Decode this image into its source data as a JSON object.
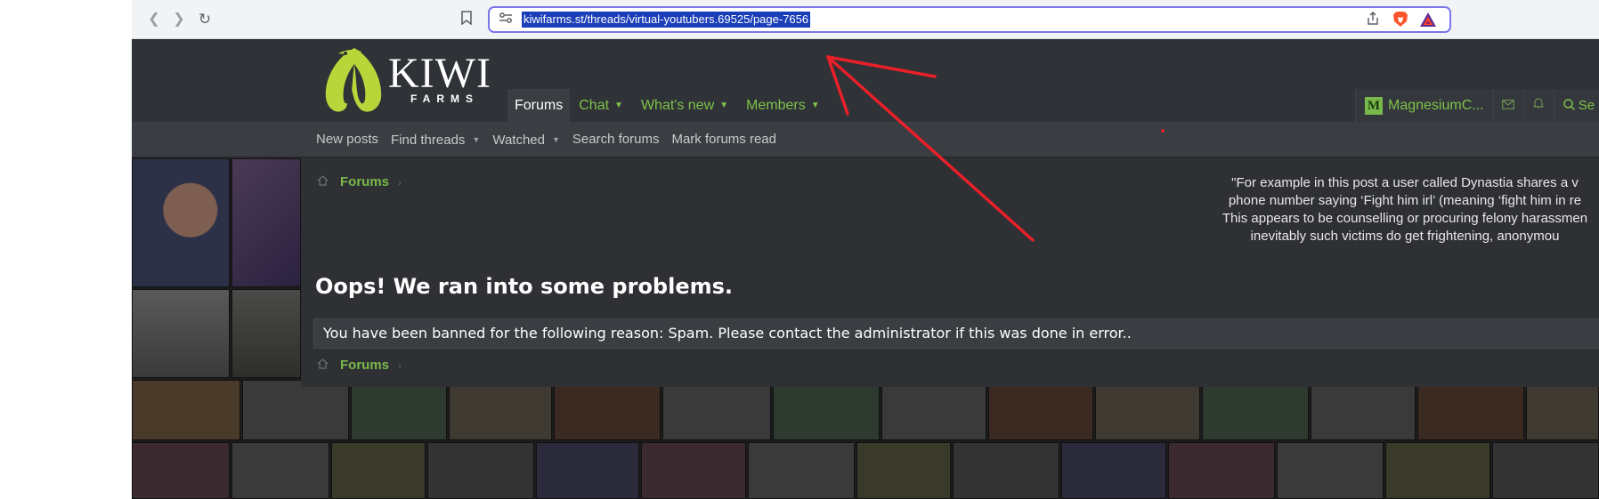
{
  "browser": {
    "url": "kiwifarms.st/threads/virtual-youtubers.69525/page-7656",
    "icons": [
      "back-icon",
      "forward-icon",
      "reload-icon",
      "bookmark-icon",
      "site-settings-icon",
      "share-icon",
      "brave-shields-icon",
      "brave-rewards-icon"
    ]
  },
  "site": {
    "logo_text": "KIWI",
    "logo_sub": "FARMS",
    "nav_tabs": [
      {
        "label": "Forums",
        "active": true,
        "has_menu": false
      },
      {
        "label": "Chat",
        "active": false,
        "has_menu": true
      },
      {
        "label": "What's new",
        "active": false,
        "has_menu": true
      },
      {
        "label": "Members",
        "active": false,
        "has_menu": true
      }
    ],
    "user": {
      "avatar_letter": "M",
      "name": "MagnesiumC..."
    },
    "search_label": "Se",
    "subnav": [
      {
        "label": "New posts",
        "has_menu": false
      },
      {
        "label": "Find threads",
        "has_menu": true
      },
      {
        "label": "Watched",
        "has_menu": true
      },
      {
        "label": "Search forums",
        "has_menu": false
      },
      {
        "label": "Mark forums read",
        "has_menu": false
      }
    ],
    "breadcrumb": "Forums",
    "quote_lines": [
      "\"For example in this post a user called Dynastia shares a v",
      "phone number saying ‘Fight him irl’ (meaning ‘fight him in re",
      "This appears to be counselling or procuring felony harassmen",
      "inevitably such victims do get frightening, anonymou"
    ],
    "error_title": "Oops! We ran into some problems.",
    "error_message": "You have been banned for the following reason: Spam. Please contact the administrator if this was done in error.."
  },
  "colors": {
    "accent_green": "#7fc24a",
    "header_bg": "#2f3236",
    "url_border": "#7b76ea",
    "url_selection": "#1a3eb8",
    "annotation_red": "#e8202a"
  }
}
